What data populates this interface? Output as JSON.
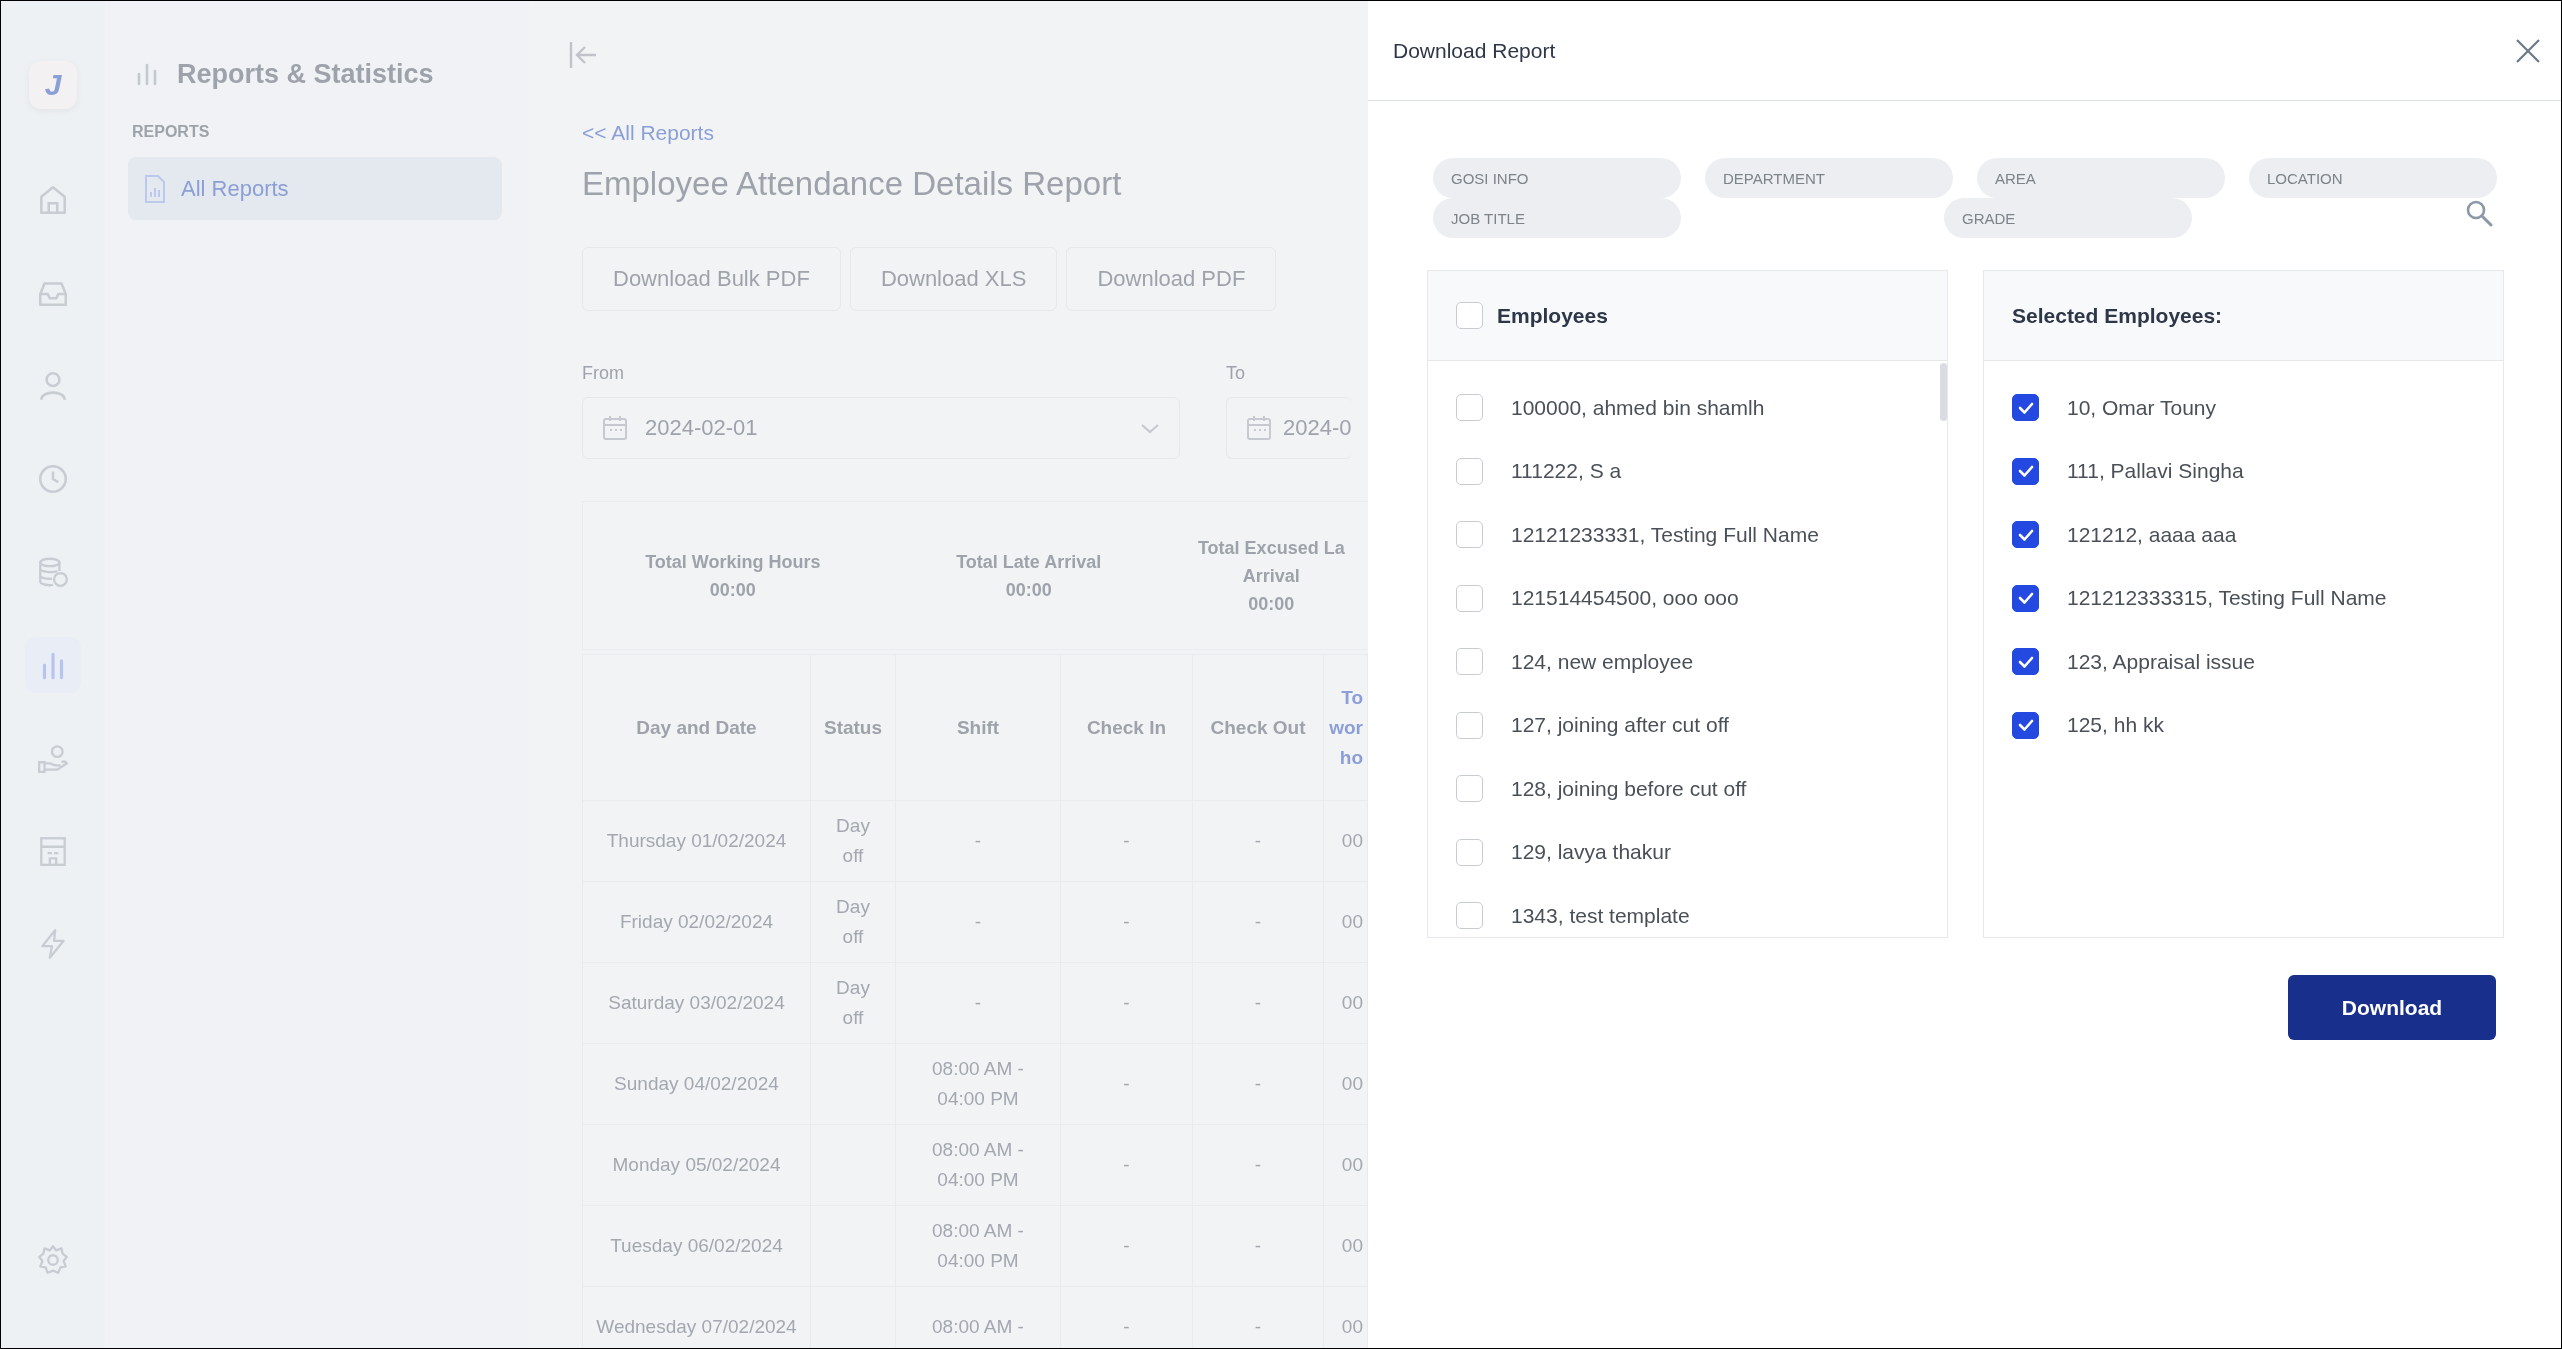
{
  "app_logo": "J",
  "nav_rail": [
    {
      "kind": "home",
      "selected": false
    },
    {
      "kind": "inbox",
      "selected": false
    },
    {
      "kind": "user",
      "selected": false
    },
    {
      "kind": "clock",
      "selected": false
    },
    {
      "kind": "database",
      "selected": false
    },
    {
      "kind": "chart",
      "selected": true
    },
    {
      "kind": "hand",
      "selected": false
    },
    {
      "kind": "building",
      "selected": false
    },
    {
      "kind": "bolt",
      "selected": false
    },
    {
      "kind": "settings",
      "selected": false
    }
  ],
  "sidebar": {
    "title": "Reports & Statistics",
    "section": "REPORTS",
    "items": [
      {
        "label": "All Reports",
        "selected": true
      }
    ]
  },
  "page": {
    "back_link": "<< All Reports",
    "title": "Employee Attendance Details Report",
    "actions": [
      "Download Bulk PDF",
      "Download XLS",
      "Download PDF"
    ],
    "from": {
      "label": "From",
      "value": "2024-02-01"
    },
    "to": {
      "label": "To",
      "value": "2024-0"
    },
    "summary": [
      {
        "label": "Total Working Hours",
        "value": "00:00"
      },
      {
        "label": "Total Late Arrival",
        "value": "00:00"
      },
      {
        "label": "Total Excused La\nArrival",
        "value": "00:00"
      }
    ],
    "table": {
      "columns": [
        "Day and Date",
        "Status",
        "Shift",
        "Check In",
        "Check Out",
        "To\nwor\nho"
      ],
      "rows": [
        [
          "Thursday 01/02/2024",
          "Day\noff",
          "-",
          "-",
          "-",
          "00"
        ],
        [
          "Friday 02/02/2024",
          "Day\noff",
          "-",
          "-",
          "-",
          "00"
        ],
        [
          "Saturday 03/02/2024",
          "Day\noff",
          "-",
          "-",
          "-",
          "00"
        ],
        [
          "Sunday 04/02/2024",
          "",
          "08:00 AM -\n04:00 PM",
          "-",
          "-",
          "00"
        ],
        [
          "Monday 05/02/2024",
          "",
          "08:00 AM -\n04:00 PM",
          "-",
          "-",
          "00"
        ],
        [
          "Tuesday 06/02/2024",
          "",
          "08:00 AM -\n04:00 PM",
          "-",
          "-",
          "00"
        ],
        [
          "Wednesday 07/02/2024",
          "",
          "08:00 AM -",
          "-",
          "-",
          "00"
        ]
      ]
    }
  },
  "dialog": {
    "title": "Download Report",
    "filters": [
      {
        "placeholder": "GOSI INFO"
      },
      {
        "placeholder": "DEPARTMENT"
      },
      {
        "placeholder": "AREA"
      },
      {
        "placeholder": "LOCATION"
      },
      {
        "placeholder": "JOB TITLE"
      },
      {
        "placeholder": "GRADE"
      }
    ],
    "employees": {
      "title": "Employees",
      "checked": false,
      "items": [
        {
          "label": "100000, ahmed bin shamlh",
          "checked": false
        },
        {
          "label": "111222, S a",
          "checked": false
        },
        {
          "label": "12121233331, Testing Full Name",
          "checked": false
        },
        {
          "label": "121514454500, ooo ooo",
          "checked": false
        },
        {
          "label": "124, new employee",
          "checked": false
        },
        {
          "label": "127, joining after cut off",
          "checked": false
        },
        {
          "label": "128, joining before cut off",
          "checked": false
        },
        {
          "label": "129, lavya thakur",
          "checked": false
        },
        {
          "label": "1343, test template",
          "checked": false
        }
      ]
    },
    "selected_employees": {
      "title": "Selected Employees:",
      "items": [
        {
          "label": "10, Omar Touny",
          "checked": true
        },
        {
          "label": "111, Pallavi Singha",
          "checked": true
        },
        {
          "label": "121212, aaaa aaa",
          "checked": true
        },
        {
          "label": "121212333315, Testing Full Name",
          "checked": true
        },
        {
          "label": "123, Appraisal issue",
          "checked": true
        },
        {
          "label": "125, hh kk",
          "checked": true
        }
      ]
    },
    "download_button": "Download"
  }
}
